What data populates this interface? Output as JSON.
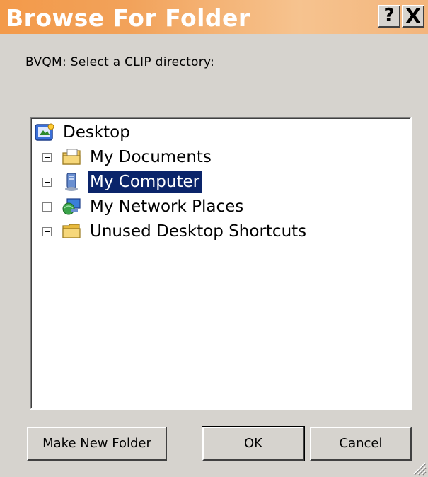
{
  "window": {
    "title": "Browse For Folder",
    "help_glyph": "?",
    "close_glyph": "X"
  },
  "prompt": "BVQM: Select a CLIP directory:",
  "tree": {
    "root": {
      "label": "Desktop",
      "icon": "desktop-icon"
    },
    "items": [
      {
        "label": "My Documents",
        "icon": "my-documents-icon",
        "selected": false
      },
      {
        "label": "My Computer",
        "icon": "my-computer-icon",
        "selected": true
      },
      {
        "label": "My Network Places",
        "icon": "network-places-icon",
        "selected": false
      },
      {
        "label": "Unused Desktop Shortcuts",
        "icon": "folder-icon",
        "selected": false
      }
    ]
  },
  "buttons": {
    "make_new_folder": "Make New Folder",
    "ok": "OK",
    "cancel": "Cancel"
  },
  "colors": {
    "title_gradient_start": "#f39a4a",
    "title_gradient_end": "#f3b57c",
    "selection": "#0a246a",
    "dialog_face": "#d6d3ce"
  }
}
